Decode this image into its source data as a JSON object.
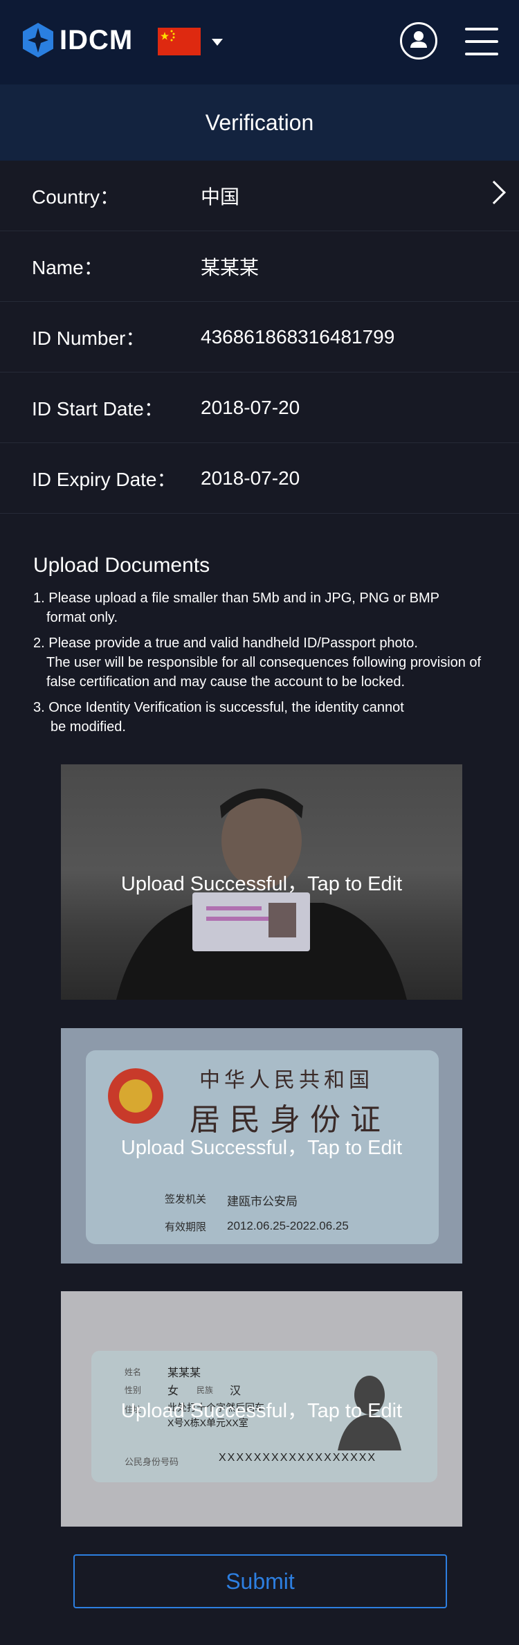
{
  "header": {
    "logo_text": "IDCM",
    "flag_icon": "china-flag-icon",
    "user_icon": "user-circle-icon",
    "menu_icon": "hamburger-menu-icon",
    "background": "#0d1a35"
  },
  "page": {
    "title": "Verification"
  },
  "form": {
    "rows": [
      {
        "label": "Country：",
        "value": "中国"
      },
      {
        "label": "Name：",
        "value": "某某某"
      },
      {
        "label": "ID Number：",
        "value": "436861868316481799"
      },
      {
        "label": "ID Start Date：",
        "value": "2018-07-20"
      },
      {
        "label": "ID Expiry Date：",
        "value": "2018-07-20"
      }
    ]
  },
  "upload": {
    "title": "Upload Documents",
    "notes": [
      {
        "first": "1. Please upload a file smaller than 5Mb and in JPG, PNG or BMP",
        "rest": "format only."
      },
      {
        "first": "2. Please provide a true and valid handheld ID/Passport photo.",
        "rest": "The user will be responsible for all consequences following provision of false certification and may cause the account to be locked."
      },
      {
        "first": "3. Once Identity Verification is successful, the identity cannot",
        "rest": "be modified."
      }
    ],
    "images": [
      {
        "status": "Upload Successful，Tap to Edit"
      },
      {
        "status": "Upload Successful，Tap to Edit",
        "card_title": "中华人民共和国",
        "card_subtitle": "居民身份证",
        "authority_label": "签发机关",
        "authority_value": "建瓯市公安局",
        "validity_label": "有效期限",
        "validity_value": "2012.06.25-2022.06.25"
      },
      {
        "status": "Upload Successful，Tap to Edit",
        "name_label": "姓名",
        "name_value": "某某某",
        "sex_label": "性别",
        "sex_value": "女",
        "ethnicity_label": "民族",
        "ethnicity_value": "汉",
        "address_label": "住址",
        "address_line1": "此处打十个字然后回车",
        "address_line2": "X号X栋X单元XX室",
        "id_label": "公民身份号码",
        "id_value": "XXXXXXXXXXXXXXXXXX"
      }
    ]
  },
  "submit": {
    "label": "Submit",
    "color": "#2d7fe1"
  }
}
